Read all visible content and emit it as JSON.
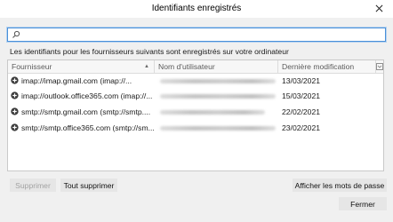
{
  "window": {
    "title": "Identifiants enregistrés"
  },
  "search": {
    "value": "",
    "placeholder": ""
  },
  "description": "Les identifiants pour les fournisseurs suivants sont enregistrés sur votre ordinateur",
  "table": {
    "columns": {
      "provider": "Fournisseur",
      "username": "Nom d'utilisateur",
      "modified": "Dernière modification"
    },
    "rows": [
      {
        "provider": "imap://imap.gmail.com (imap://...",
        "modified": "13/03/2021"
      },
      {
        "provider": "imap://outlook.office365.com (imap://...",
        "modified": "15/03/2021"
      },
      {
        "provider": "smtp://smtp.gmail.com (smtp://smtp....",
        "modified": "22/02/2021"
      },
      {
        "provider": "smtp://smtp.office365.com (smtp://sm...",
        "modified": "23/02/2021"
      }
    ]
  },
  "buttons": {
    "delete_label": "Supprimer",
    "delete_all_label": "Tout supprimer",
    "show_passwords_label": "Afficher les mots de passe",
    "close_label": "Fermer"
  },
  "colors": {
    "accent": "#4a90d9",
    "window_bg": "#f0f0f0",
    "button_bg": "#e6e6e6"
  },
  "icons": {
    "close": "close-icon",
    "search": "search-icon",
    "sort": "sort-ascending-icon",
    "column_picker": "column-picker-icon",
    "row_expander": "expand-plus-icon"
  }
}
